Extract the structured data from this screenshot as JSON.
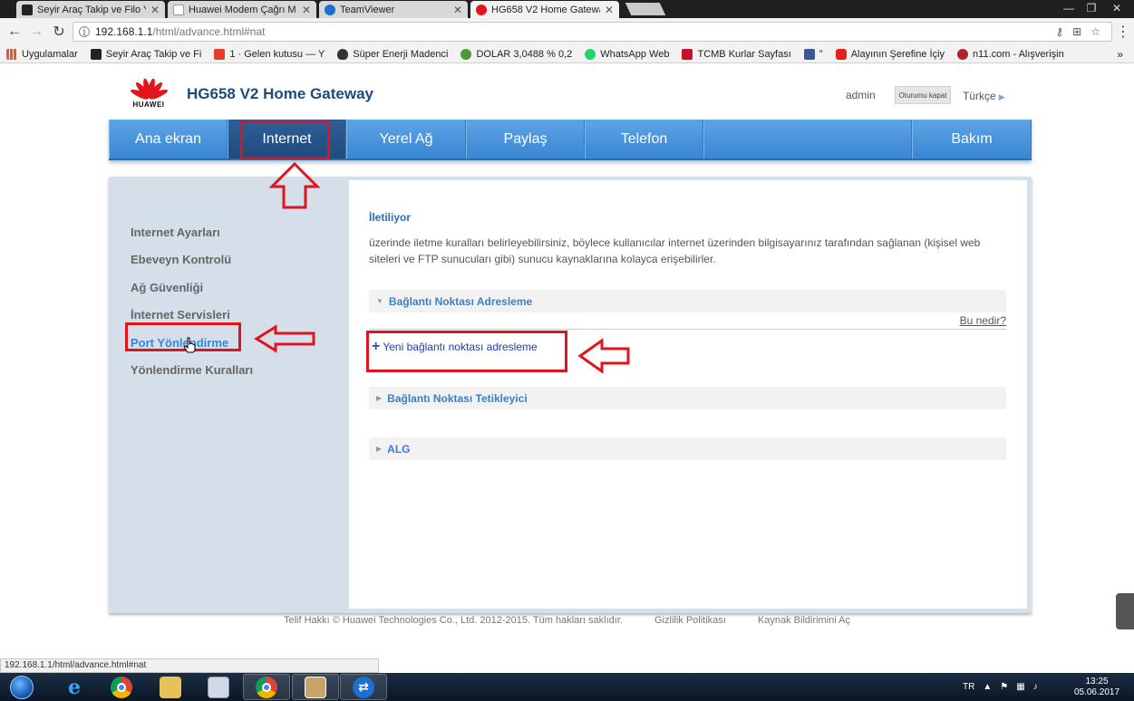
{
  "browser": {
    "tabs": [
      {
        "title": "Seyir Araç Takip ve Filo Y",
        "favicon_color": "#222222",
        "favicon_text": "SEYIR"
      },
      {
        "title": "Huawei Modem Çağrı M",
        "favicon_color": "#ffffff",
        "favicon_text": ""
      },
      {
        "title": "TeamViewer",
        "favicon_color": "#1b6fd1",
        "favicon_text": ""
      },
      {
        "title": "HG658 V2 Home Gatewa",
        "favicon_color": "#e3141b",
        "favicon_text": ""
      }
    ],
    "address": {
      "host": "192.168.1.1",
      "path": "/html/advance.html#nat"
    },
    "bookmarks": [
      {
        "label": "Uygulamalar",
        "icon": "apps-grid-icon",
        "color": "#e25a2b"
      },
      {
        "label": "Seyir Araç Takip ve Fi",
        "icon": "seyir-icon",
        "color": "#222222"
      },
      {
        "label": "1 · Gelen kutusu — Y",
        "icon": "mail-icon",
        "color": "#e43b2c"
      },
      {
        "label": "Süper Enerji Madenci",
        "icon": "shield-icon",
        "color": "#333333"
      },
      {
        "label": "DOLAR 3,0488 % 0,2",
        "icon": "coin-icon",
        "color": "#4a9b3c"
      },
      {
        "label": "WhatsApp Web",
        "icon": "whatsapp-icon",
        "color": "#25d366"
      },
      {
        "label": "TCMB Kurlar Sayfası",
        "icon": "tcmb-icon",
        "color": "#c8102e"
      },
      {
        "label": "\"",
        "icon": "facebook-icon",
        "color": "#3b5998"
      },
      {
        "label": "Alayının Şerefine İçiy",
        "icon": "youtube-icon",
        "color": "#e62117"
      },
      {
        "label": "n11.com - Alışverişin",
        "icon": "n11-icon",
        "color": "#b3222b"
      }
    ],
    "status_url": "192.168.1.1/html/advance.html#nat"
  },
  "gateway": {
    "brand": "HUAWEI",
    "title": "HG658 V2 Home Gateway",
    "user": "admin",
    "logout": "Oturumu kapat",
    "language": "Türkçe",
    "nav": [
      {
        "label": "Ana ekran",
        "active": false
      },
      {
        "label": "Internet",
        "active": true
      },
      {
        "label": "Yerel Ağ",
        "active": false
      },
      {
        "label": "Paylaş",
        "active": false
      },
      {
        "label": "Telefon",
        "active": false
      },
      {
        "label": "",
        "active": false
      },
      {
        "label": "Bakım",
        "active": false
      }
    ],
    "sidebar": [
      {
        "label": "Internet Ayarları",
        "active": false
      },
      {
        "label": "Ebeveyn Kontrolü",
        "active": false
      },
      {
        "label": "Ağ Güvenliği",
        "active": false
      },
      {
        "label": "İnternet Servisleri",
        "active": false
      },
      {
        "label": "Port Yönlendirme",
        "active": true
      },
      {
        "label": "Yönlendirme Kuralları",
        "active": false
      }
    ],
    "panel": {
      "title": "İletiliyor",
      "description": "üzerinde iletme kuralları belirleyebilirsiniz, böylece kullanıcılar internet üzerinden bilgisayarınız tarafından sağlanan (kişisel web siteleri ve FTP sunucuları gibi) sunucu kaynaklarına kolayca erişebilirler.",
      "section1": "Bağlantı Noktası Adresleme",
      "help": "Bu nedir?",
      "add_new": "Yeni bağlantı noktası adresleme",
      "section2": "Bağlantı Noktası Tetikleyici",
      "section3": "ALG"
    },
    "footer": {
      "copyright": "Telif Hakkı © Huawei Technologies Co., Ltd. 2012-2015. Tüm hakları saklıdır.",
      "privacy": "Gizlilik Politikası",
      "source": "Kaynak Bildirimini Aç"
    }
  },
  "annotation_color": "#e0141e",
  "taskbar": {
    "lang": "TR",
    "time": "13:25",
    "date": "05.06.2017"
  }
}
